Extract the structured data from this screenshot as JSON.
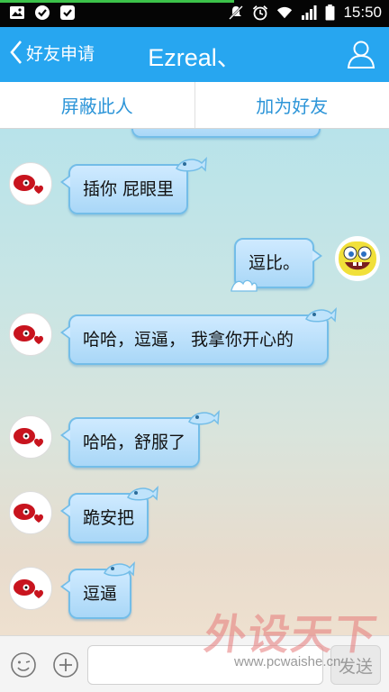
{
  "status_bar": {
    "time": "15:50",
    "left_icons": [
      "image-icon",
      "check-circle-icon",
      "check-square-icon"
    ],
    "right_icons": [
      "mute-icon",
      "alarm-icon",
      "wifi-icon",
      "signal-icon",
      "battery-icon"
    ]
  },
  "header": {
    "back_label": "好友申请",
    "title": "Ezreal、",
    "profile_icon": "person-icon",
    "color": "#27a6f0"
  },
  "actions": {
    "block_label": "屏蔽此人",
    "add_friend_label": "加为好友"
  },
  "messages": [
    {
      "side": "left",
      "text": "插你 屁眼里"
    },
    {
      "side": "right",
      "text": "逗比。"
    },
    {
      "side": "left",
      "text": "哈哈，逗逼， 我拿你开心的"
    },
    {
      "side": "left",
      "text": "哈哈，舒服了"
    },
    {
      "side": "left",
      "text": "跪安把"
    },
    {
      "side": "left",
      "text": "逗逼"
    }
  ],
  "input_bar": {
    "emoji_icon": "emoji-icon",
    "plus_icon": "plus-icon",
    "message_value": "",
    "send_label": "发送"
  },
  "watermark": {
    "logo_text": "外设天下",
    "url": "www.pcwaishe.cn"
  }
}
